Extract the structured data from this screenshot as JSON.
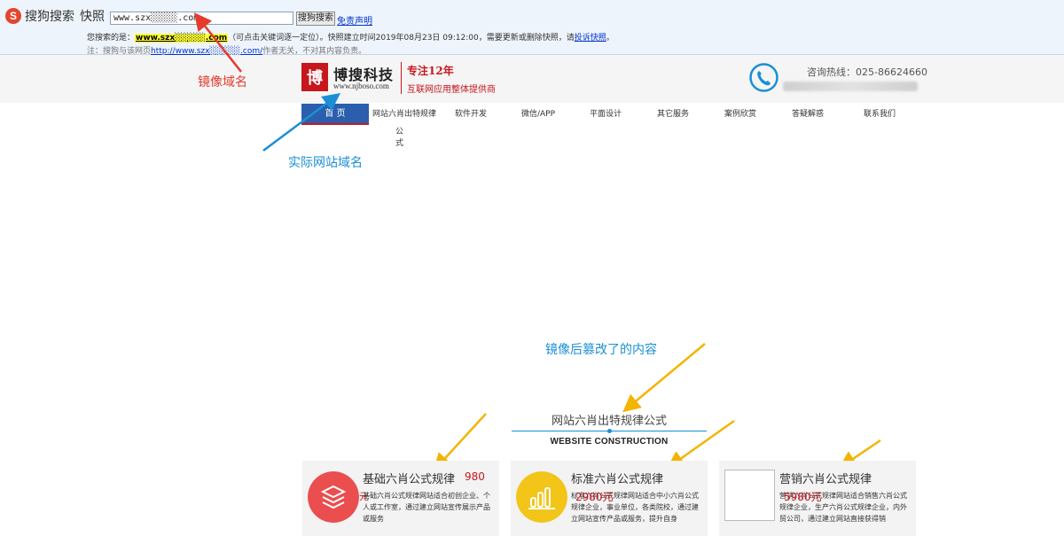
{
  "snapshot_bar": {
    "logo_letter": "S",
    "logo_text": "搜狗搜索",
    "snapshot_label": "快照",
    "url_value": "www.szx░░░░░.com",
    "search_button": "搜狗搜索",
    "disclaimer_link": "免责声明",
    "line1_prefix": "您搜索的是：",
    "line1_highlight": "www.szx░░░░░.com",
    "line1_middle": "（可点击关键词逐一定位）。快照建立时间2019年08月23日 09:12:00，需要更新或删除快照，请",
    "line1_link": "投诉快照",
    "line1_end": "。",
    "line2_prefix": "注：搜狗与该网页",
    "line2_link": "http://www.szx░░░░░.com/",
    "line2_suffix": "作者无关，不对其内容负责。"
  },
  "header": {
    "brand_mark": "博",
    "brand_name": "博搜科技",
    "brand_url": "www.njboso.com",
    "slogan_title": "专注12年",
    "slogan_sub": "互联网应用整体提供商",
    "hotline": "咨询热线：025-86624660"
  },
  "nav": {
    "items": [
      "首 页",
      "网站六肖出特规律",
      "软件开发",
      "微信/APP",
      "平面设计",
      "其它服务",
      "案例欣赏",
      "答疑解惑",
      "联系我们"
    ],
    "wrap_text": "公式"
  },
  "annotations": {
    "mirror_domain": "镜像域名",
    "real_domain": "实际网站域名",
    "tampered": "镜像后篡改了的内容"
  },
  "section": {
    "title": "网站六肖出特规律公式",
    "subtitle": "WEBSITE CONSTRUCTION"
  },
  "cards": [
    {
      "title": "基础六肖公式规律",
      "price": "980",
      "price_tail": "元",
      "desc": "基础六肖公式规律网站适合初创企业、个人或工作室，通过建立网站宣传展示产品或服务",
      "icon": "layers-icon"
    },
    {
      "title": "标准六肖公式规律",
      "price": "2980元",
      "desc": "标准六肖公式规律网站适合中小六肖公式规律企业，事业单位，各类院校，通过建立网站宣传产品或服务，提升自身",
      "icon": "bar-chart-icon"
    },
    {
      "title": "营销六肖公式规律",
      "price": "5980元",
      "desc": "营销六肖公式规律网站适合销售六肖公式规律企业，生产六肖公式规律企业，内外贸公司，通过建立网站直接获得销",
      "icon": "broken-image-icon"
    }
  ],
  "colors": {
    "brand_red": "#c8161d",
    "nav_active": "#2b5fae",
    "annotation_red": "#e53b2c",
    "annotation_blue": "#1a8fd6",
    "annotation_yellow": "#f4b400"
  }
}
